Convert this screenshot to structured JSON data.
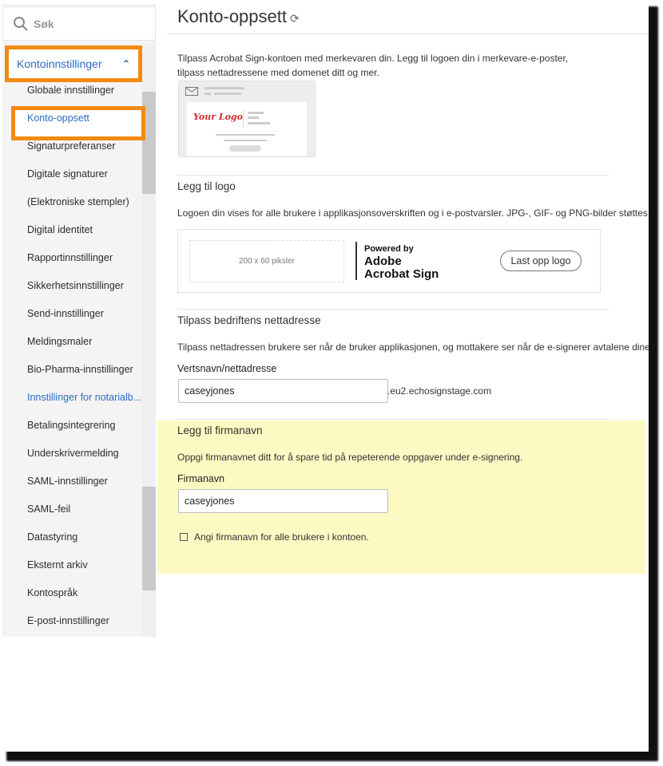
{
  "sidebar": {
    "search_placeholder": "Søk",
    "group_label": "Kontoinnstillinger",
    "items": [
      {
        "label": "Globale innstillinger"
      },
      {
        "label": "Konto-oppsett",
        "active": true
      },
      {
        "label": "Signaturpreferanser"
      },
      {
        "label": "Digitale signaturer"
      },
      {
        "label": "(Elektroniske stempler)"
      },
      {
        "label": "Digital identitet"
      },
      {
        "label": "Rapportinnstillinger"
      },
      {
        "label": "Sikkerhetsinnstillinger"
      },
      {
        "label": "Send-innstillinger"
      },
      {
        "label": "Meldingsmaler"
      },
      {
        "label": "Bio-Pharma-innstillinger"
      },
      {
        "label": "Innstillinger for notarialb...",
        "link": true
      },
      {
        "label": "Betalingsintegrering"
      },
      {
        "label": "Underskrivermelding"
      },
      {
        "label": "SAML-innstillinger"
      },
      {
        "label": "SAML-feil"
      },
      {
        "label": "Datastyring"
      },
      {
        "label": "Eksternt arkiv"
      },
      {
        "label": "Kontospråk"
      },
      {
        "label": "E-post-innstillinger"
      }
    ]
  },
  "main": {
    "title": "Konto-oppsett",
    "intro_line1": "Tilpass Acrobat Sign-kontoen med merkevaren din. Legg til logoen din i merkevare-e-poster,",
    "intro_line2": "tilpass nettadressene med domenet ditt og mer.",
    "preview_logo_text": "Your Logo",
    "logo_section": {
      "title": "Legg til logo",
      "description": "Logoen din vises for alle brukere i applikasjonsoverskriften og i e-postvarsler. JPG-, GIF- og PNG-bilder støttes.",
      "placeholder_size": "200 x 60 piksler",
      "powered_by": "Powered by",
      "brand_line1": "Adobe",
      "brand_line2": "Acrobat Sign",
      "upload_button": "Last opp logo"
    },
    "url_section": {
      "title": "Tilpass bedriftens nettadresse",
      "description": "Tilpass nettadressen brukere ser når de bruker applikasjonen, og mottakere ser når de e-signerer avtalene dine.",
      "field_label": "Vertsnavn/nettadresse",
      "field_value": "caseyjones",
      "domain_suffix": ".eu2.echosignstage.com"
    },
    "company_section": {
      "title": "Legg til firmanavn",
      "description": "Oppgi firmanavnet ditt for å spare tid på repeterende oppgaver under e-signering.",
      "field_label": "Firmanavn",
      "field_value": "caseyjones",
      "checkbox_label": "Angi firmanavn for alle brukere i kontoen.",
      "checkbox_checked": false
    }
  },
  "colors": {
    "highlight_border": "#f28a14",
    "highlight_bg": "#fdf9c3",
    "link": "#2b6cc4"
  }
}
